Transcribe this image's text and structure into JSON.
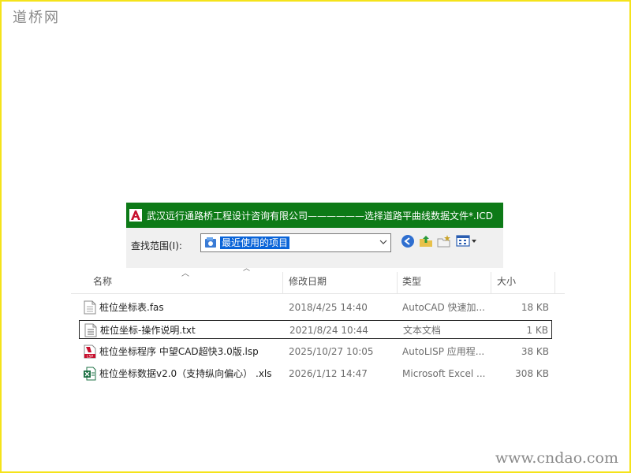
{
  "watermark": {
    "top": "道桥网",
    "bottom": "www.cndao.com"
  },
  "window": {
    "title": "武汉远行通路桥工程设计咨询有限公司——————选择道路平曲线数据文件*.ICD"
  },
  "lookin": {
    "label": "查找范围(I):",
    "value": "最近使用的项目",
    "icons": [
      "back-icon",
      "up-folder-icon",
      "new-folder-icon",
      "view-menu-icon"
    ]
  },
  "columns": {
    "name": "名称",
    "date": "修改日期",
    "type": "类型",
    "size": "大小"
  },
  "files": [
    {
      "name": "桩位坐标表.fas",
      "date": "2018/4/25 14:40",
      "type": "AutoCAD 快速加...",
      "size": "18 KB",
      "icon": "fas-file-icon"
    },
    {
      "name": "桩位坐标-操作说明.txt",
      "date": "2021/8/24 10:44",
      "type": "文本文档",
      "size": "1 KB",
      "icon": "txt-file-icon"
    },
    {
      "name": "桩位坐标程序 中望CAD超快3.0版.lsp",
      "date": "2025/10/27 10:05",
      "type": "AutoLISP 应用程...",
      "size": "38 KB",
      "icon": "lsp-file-icon"
    },
    {
      "name": "桩位坐标数据v2.0（支持纵向偏心） .xls",
      "date": "2026/1/12 14:47",
      "type": "Microsoft Excel ...",
      "size": "308 KB",
      "icon": "xls-file-icon"
    }
  ],
  "colors": {
    "titlebar": "#0d7a17",
    "selection": "#0a64d8",
    "border": "#f5e31a"
  }
}
